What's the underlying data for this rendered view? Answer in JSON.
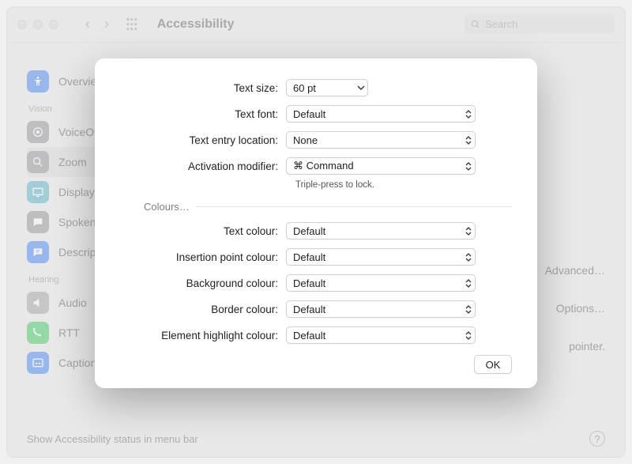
{
  "window": {
    "title": "Accessibility",
    "search_placeholder": "Search"
  },
  "sidebar": {
    "items": [
      {
        "label": "Overview"
      }
    ],
    "group_vision": "Vision",
    "vision_items": [
      {
        "label": "VoiceOver"
      },
      {
        "label": "Zoom"
      },
      {
        "label": "Display"
      },
      {
        "label": "Spoken Content"
      },
      {
        "label": "Descriptions"
      }
    ],
    "group_hearing": "Hearing",
    "hearing_items": [
      {
        "label": "Audio"
      },
      {
        "label": "RTT"
      },
      {
        "label": "Captions"
      }
    ]
  },
  "right_side": {
    "advanced": "Advanced…",
    "options": "Options…",
    "pointer_hint": "pointer."
  },
  "footer": {
    "status_label": "Show Accessibility status in menu bar"
  },
  "sheet": {
    "rows": {
      "text_size": {
        "label": "Text size:",
        "value": "60 pt"
      },
      "text_font": {
        "label": "Text font:",
        "value": "Default"
      },
      "entry_location": {
        "label": "Text entry location:",
        "value": "None"
      },
      "activation": {
        "label": "Activation modifier:",
        "value": "⌘ Command",
        "note": "Triple-press to lock."
      }
    },
    "section_colours": "Colours…",
    "colour_rows": {
      "text": {
        "label": "Text colour:",
        "value": "Default"
      },
      "insertion": {
        "label": "Insertion point colour:",
        "value": "Default"
      },
      "background": {
        "label": "Background colour:",
        "value": "Default"
      },
      "border": {
        "label": "Border colour:",
        "value": "Default"
      },
      "highlight": {
        "label": "Element highlight colour:",
        "value": "Default"
      }
    },
    "ok": "OK"
  }
}
